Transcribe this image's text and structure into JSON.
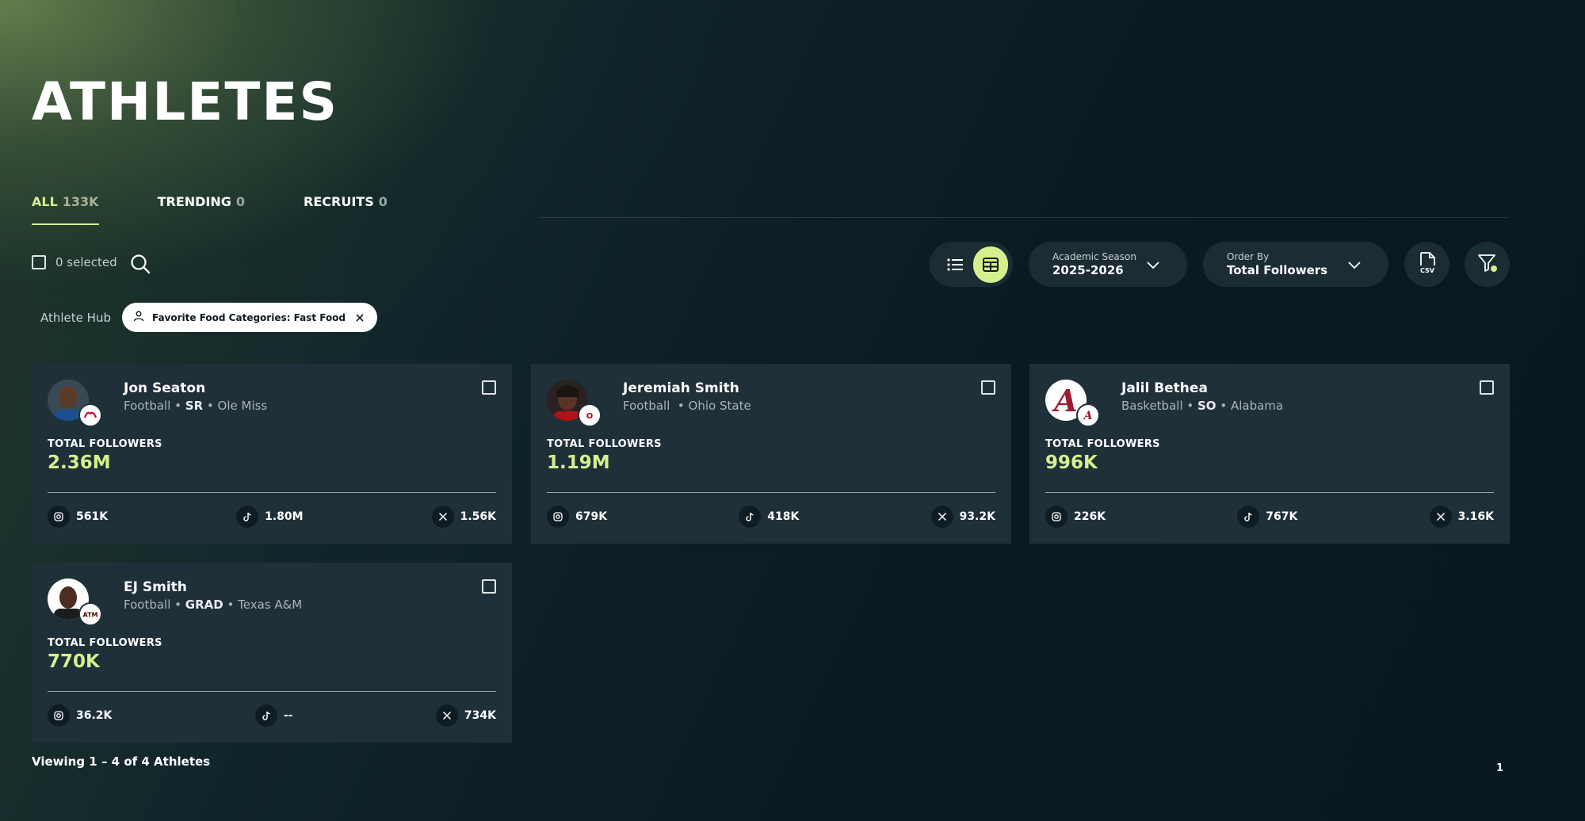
{
  "page": {
    "title": "ATHLETES"
  },
  "tabs": [
    {
      "label": "ALL",
      "count": "133K",
      "active": true
    },
    {
      "label": "TRENDING",
      "count": "0"
    },
    {
      "label": "RECRUITS",
      "count": "0"
    }
  ],
  "toolbar": {
    "selected_label": "0 selected",
    "season": {
      "label": "Academic Season",
      "value": "2025-2026"
    },
    "order": {
      "label": "Order By",
      "value": "Total Followers"
    },
    "csv_icon_text": "CSV",
    "icons": {
      "search": "search-icon",
      "list_view": "list-view-icon",
      "grid_view": "grid-view-icon",
      "csv": "csv-file-icon",
      "filter": "filter-icon"
    }
  },
  "filters": {
    "hub_label": "Athlete Hub",
    "chip_text": "Favorite Food Categories: Fast Food"
  },
  "athletes": [
    {
      "name": "Jon Seaton",
      "sport": "Football",
      "class": "SR",
      "school": "Ole Miss",
      "badge": "Ole Miss",
      "badge_color": "#c8102e",
      "total_label": "TOTAL FOLLOWERS",
      "total": "2.36M",
      "instagram": "561K",
      "tiktok": "1.80M",
      "x": "1.56K"
    },
    {
      "name": "Jeremiah Smith",
      "sport": "Football",
      "class": "",
      "school": "Ohio State",
      "badge": "OSU",
      "badge_color": "#bb0000",
      "total_label": "TOTAL FOLLOWERS",
      "total": "1.19M",
      "instagram": "679K",
      "tiktok": "418K",
      "x": "93.2K"
    },
    {
      "name": "Jalil Bethea",
      "sport": "Basketball",
      "class": "SO",
      "school": "Alabama",
      "badge": "A",
      "badge_color": "#9e1b32",
      "total_label": "TOTAL FOLLOWERS",
      "total": "996K",
      "instagram": "226K",
      "tiktok": "767K",
      "x": "3.16K"
    },
    {
      "name": "EJ Smith",
      "sport": "Football",
      "class": "GRAD",
      "school": "Texas A&M",
      "badge": "ATM",
      "badge_color": "#500000",
      "total_label": "TOTAL FOLLOWERS",
      "total": "770K",
      "instagram": "36.2K",
      "tiktok": "--",
      "x": "734K"
    }
  ],
  "footer": {
    "viewing": "Viewing 1 – 4 of 4 Athletes",
    "page": "1"
  },
  "colors": {
    "accent": "#d7f08f",
    "card_bg": "#203038",
    "pill_bg": "#1c2c33"
  }
}
